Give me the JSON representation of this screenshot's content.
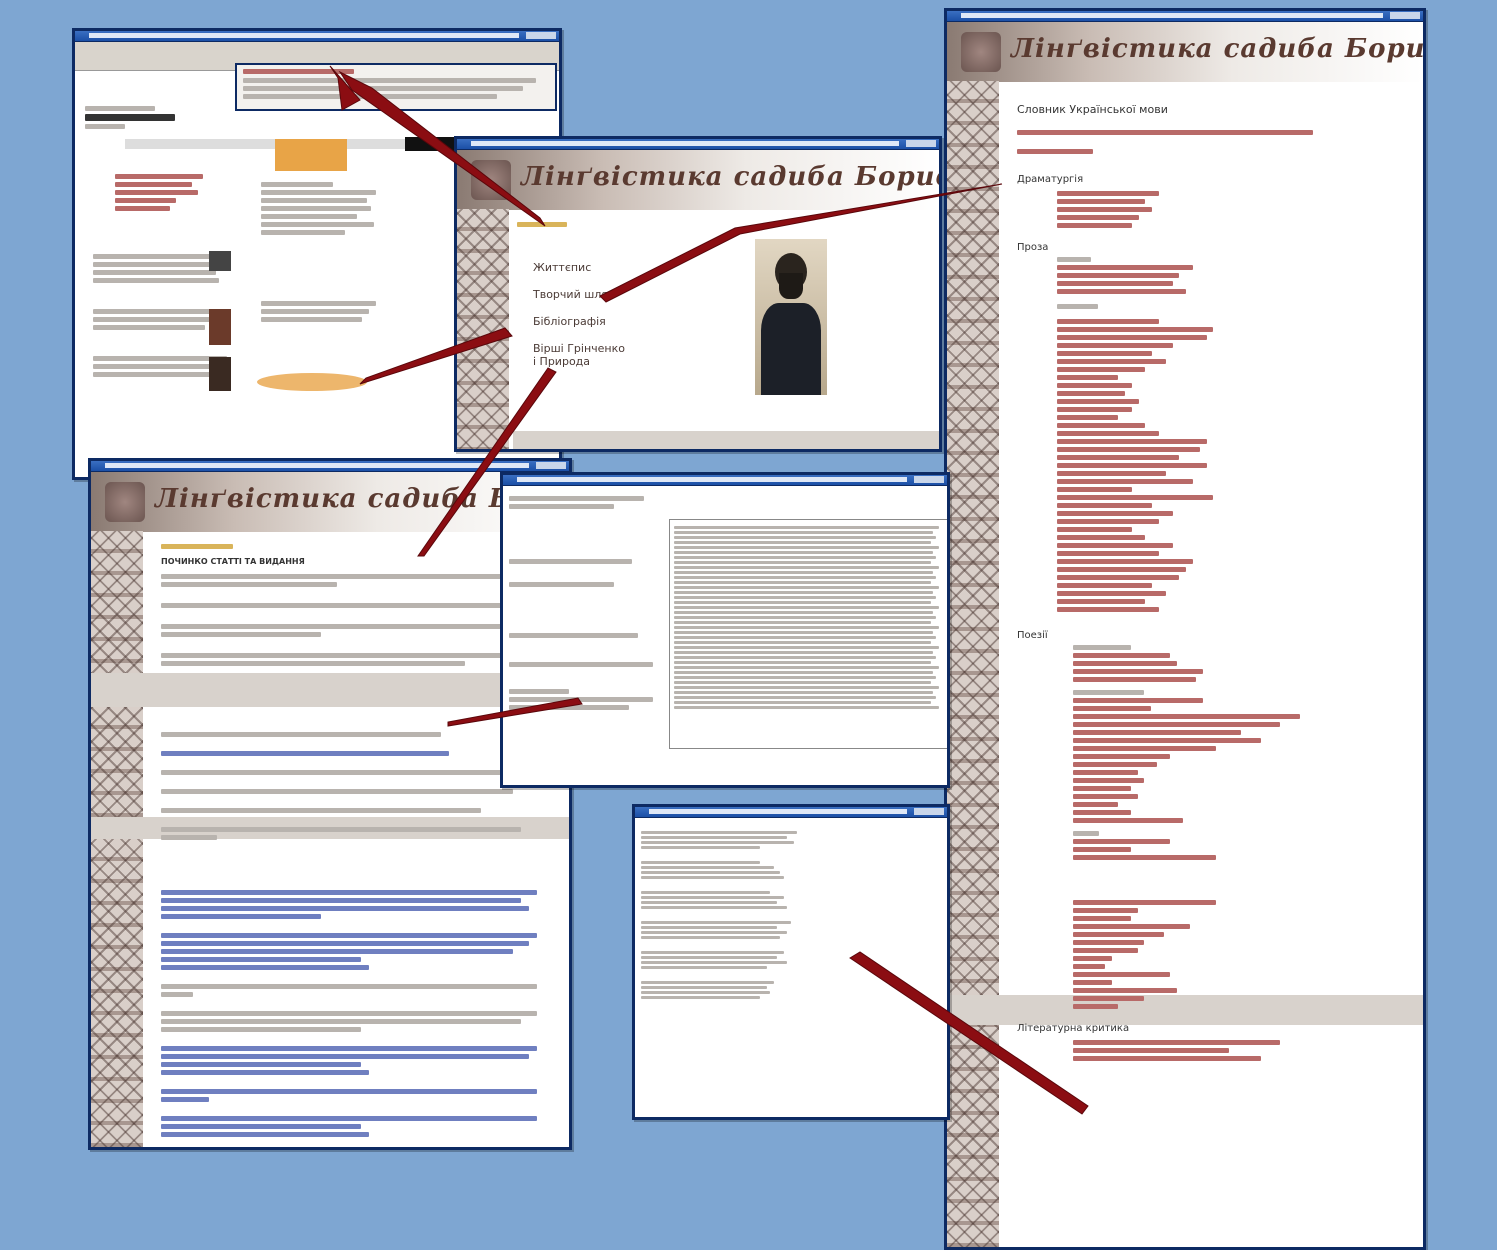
{
  "site_title": "Лінґвістика садиба Бориса Грінченка",
  "main_window": {
    "menu": [
      "Життєпис",
      "Творчий шлях",
      "Бібліографія",
      "Вірші Грінченко",
      "і Природа"
    ],
    "menu_lines": [
      [
        "Життєпис"
      ],
      [
        "Творчий шлях"
      ],
      [
        "Бібліографія"
      ],
      [
        "Вірші Грінченко",
        "і Природа"
      ]
    ]
  },
  "right_window": {
    "title": "Словник Української мови",
    "sections": [
      "Драматургія",
      "Проза",
      "Поезії",
      "Літературна критика"
    ]
  },
  "left_bottom_window": {
    "heading": "ПОЧИНКО СТАТТІ ТА ВИДАННЯ"
  },
  "colors": {
    "background": "#7ea6d2",
    "frame": "#0d2a63",
    "arrow": "#8b0d12",
    "link": "#7a1a1a"
  }
}
